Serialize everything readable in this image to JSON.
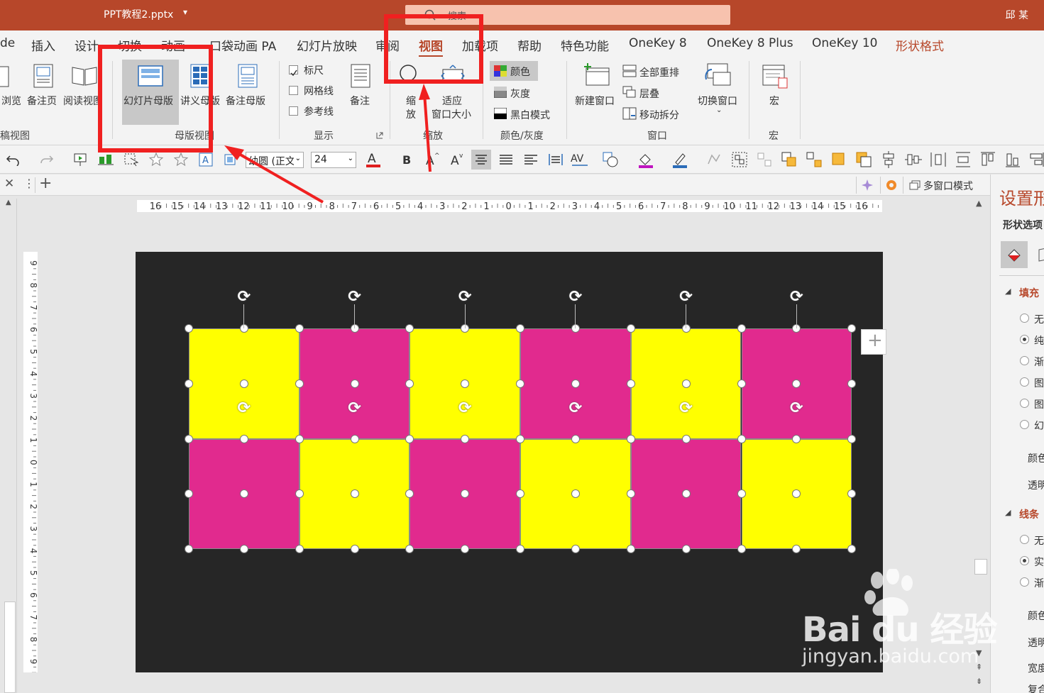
{
  "titlebar": {
    "filename": "PPT教程2.pptx",
    "dropdown": "▾",
    "search_placeholder": "搜索",
    "user": "邱 某"
  },
  "tabs": [
    {
      "label": "de"
    },
    {
      "label": "插入"
    },
    {
      "label": "设计"
    },
    {
      "label": "切换"
    },
    {
      "label": "动画"
    },
    {
      "label": "口袋动画 PA"
    },
    {
      "label": "幻灯片放映"
    },
    {
      "label": "审阅"
    },
    {
      "label": "视图"
    },
    {
      "label": "加载项"
    },
    {
      "label": "帮助"
    },
    {
      "label": "特色功能"
    },
    {
      "label": "OneKey 8"
    },
    {
      "label": "OneKey 8 Plus"
    },
    {
      "label": "OneKey 10"
    },
    {
      "label": "形状格式"
    }
  ],
  "ribbon": {
    "browse": "浏览",
    "notes_page": "备注页",
    "reading_view": "阅读视图",
    "group_presentation_views": "稿视图",
    "slide_master": "幻灯片母版",
    "handout_master": "讲义母版",
    "notes_master": "备注母版",
    "group_master_views": "母版视图",
    "ruler": "标尺",
    "gridlines": "网格线",
    "guides": "参考线",
    "notes": "备注",
    "group_show": "显示",
    "zoom_1": "缩",
    "zoom_2": "放",
    "fit_1": "适应",
    "fit_2": "窗口大小",
    "group_zoom": "缩放",
    "color": "颜色",
    "grayscale": "灰度",
    "black_white": "黑白模式",
    "group_color": "颜色/灰度",
    "new_window": "新建窗口",
    "arrange_all": "全部重排",
    "cascade": "层叠",
    "move_split": "移动拆分",
    "group_window": "窗口",
    "switch_window": "切换窗口",
    "macros": "宏",
    "group_macros": "宏"
  },
  "toolbar2": {
    "font_name": "幼圆 (正文",
    "font_size": "24"
  },
  "tabstrip": {
    "multiwindow": "多窗口模式"
  },
  "ruler": {
    "h_ticks": [
      "16",
      "15",
      "14",
      "13",
      "12",
      "11",
      "10",
      "9",
      "8",
      "7",
      "6",
      "5",
      "4",
      "3",
      "2",
      "1",
      "0",
      "1",
      "2",
      "3",
      "4",
      "5",
      "6",
      "7",
      "8",
      "9",
      "10",
      "11",
      "12",
      "13",
      "14",
      "15",
      "16"
    ],
    "v_ticks": [
      "9",
      "8",
      "7",
      "6",
      "5",
      "4",
      "3",
      "2",
      "1",
      "0",
      "1",
      "2",
      "3",
      "4",
      "5",
      "6",
      "7",
      "8",
      "9"
    ]
  },
  "rightpanel": {
    "title": "设置形",
    "shape_options": "形状选项",
    "fill": "填充",
    "fill_opts": [
      "无",
      "纯",
      "渐",
      "图",
      "图",
      "幻"
    ],
    "color": "颜色",
    "transparency": "透明",
    "line": "线条",
    "line_opts": [
      "无",
      "实",
      "渐"
    ],
    "line_color": "颜色",
    "line_transparency": "透明",
    "width": "宽度",
    "compound": "复合"
  },
  "slide": {
    "rows": [
      [
        "#ffff00",
        "#e12a8e",
        "#ffff00",
        "#e12a8e",
        "#ffff00",
        "#e12a8e"
      ],
      [
        "#e12a8e",
        "#ffff00",
        "#e12a8e",
        "#ffff00",
        "#e12a8e",
        "#ffff00"
      ]
    ]
  },
  "watermark": {
    "brand": "Bai du 经验",
    "url": "jingyan.baidu.com"
  },
  "colors": {
    "accent": "#b7472a",
    "annotation": "#f02020",
    "yellow": "#ffff00",
    "magenta": "#e12a8e"
  }
}
